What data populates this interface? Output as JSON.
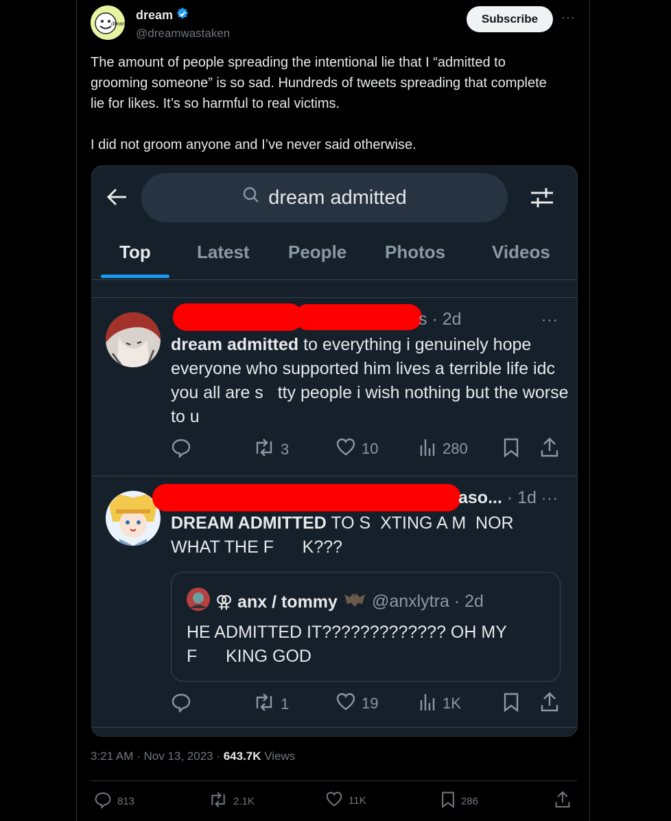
{
  "author": {
    "name": "dream",
    "handle": "@dreamwastaken",
    "avatar_text": "dream",
    "subscribe_label": "Subscribe",
    "more": "···"
  },
  "tweet_text": "The amount of people spreading the intentional lie that I “admitted to grooming someone” is so sad. Hundreds of tweets spreading that complete lie for likes. It’s so harmful to real victims.\n\nI did not groom anyone and I’ve never said otherwise.",
  "screenshot": {
    "search_query": "dream admitted",
    "tabs": [
      {
        "label": "Top",
        "active": true
      },
      {
        "label": "Latest",
        "active": false
      },
      {
        "label": "People",
        "active": false
      },
      {
        "label": "Photos",
        "active": false
      },
      {
        "label": "Videos",
        "active": false
      }
    ],
    "posts": [
      {
        "meta": "s · 2d",
        "more": "···",
        "body_bold": "dream admitted",
        "body_rest": " to everything i genuinely hope everyone who supported him lives a terrible life idc you all are s   tty people i wish nothing but the worse to u",
        "replies": "",
        "reposts": "3",
        "likes": "10",
        "views": "280"
      },
      {
        "meta": "aso... · 1d",
        "more": "···",
        "body_bold": "DREAM ADMITTED",
        "body_rest": " TO S  XTING A M  NOR\nWHAT THE F      K???",
        "quote": {
          "name": "⚢ anx / tommy",
          "handle": "@anxlytra · 2d",
          "body": "HE ADMITTED IT????????????? OH MY\nF      KING GOD"
        },
        "replies": "",
        "reposts": "1",
        "likes": "19",
        "views": "1K"
      }
    ]
  },
  "footer": {
    "time": "3:21 AM · Nov 13, 2023 · ",
    "views_count": "643.7K",
    "views_label": " Views",
    "replies": "813",
    "reposts": "2.1K",
    "likes": "11K",
    "bookmarks": "286"
  },
  "colors": {
    "accent": "#1d9bf0",
    "background": "#000000",
    "dim_background": "#15202b",
    "redaction": "#ff0000"
  }
}
